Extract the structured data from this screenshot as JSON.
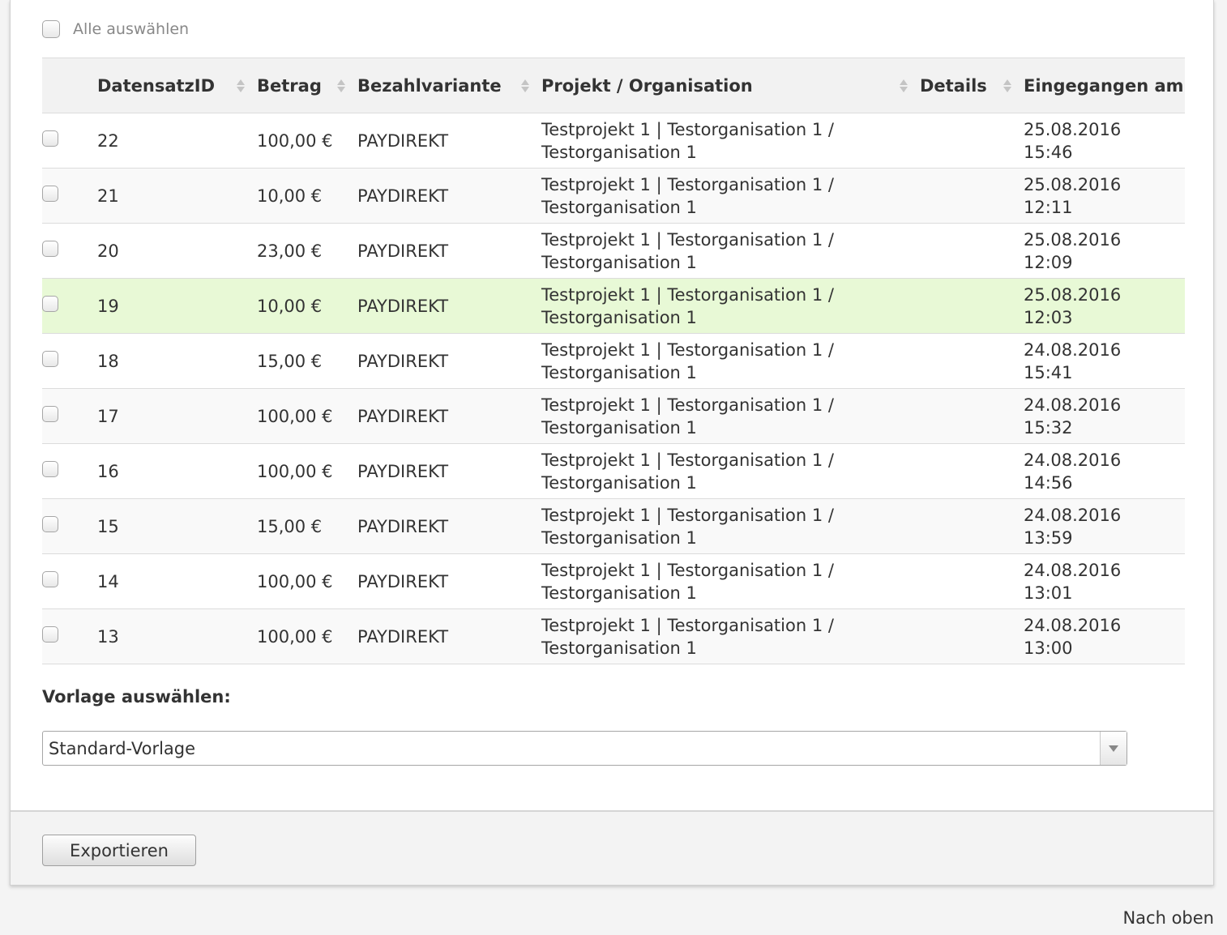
{
  "select_all": {
    "label": "Alle auswählen"
  },
  "table": {
    "headers": {
      "id": "DatensatzID",
      "amount": "Betrag",
      "payment": "Bezahlvariante",
      "project": "Projekt / Organisation",
      "details": "Details",
      "received": "Eingegangen am"
    },
    "rows": [
      {
        "id": "22",
        "amount": "100,00 €",
        "payment": "PAYDIREKT",
        "project": "Testprojekt 1 | Testorganisation 1 / Testorganisation 1",
        "details": "",
        "date": "25.08.2016",
        "time": "15:46"
      },
      {
        "id": "21",
        "amount": "10,00 €",
        "payment": "PAYDIREKT",
        "project": "Testprojekt 1 | Testorganisation 1 / Testorganisation 1",
        "details": "",
        "date": "25.08.2016",
        "time": "12:11"
      },
      {
        "id": "20",
        "amount": "23,00 €",
        "payment": "PAYDIREKT",
        "project": "Testprojekt 1 | Testorganisation 1 / Testorganisation 1",
        "details": "",
        "date": "25.08.2016",
        "time": "12:09"
      },
      {
        "id": "19",
        "amount": "10,00 €",
        "payment": "PAYDIREKT",
        "project": "Testprojekt 1 | Testorganisation 1 / Testorganisation 1",
        "details": "",
        "date": "25.08.2016",
        "time": "12:03",
        "highlighted": true
      },
      {
        "id": "18",
        "amount": "15,00 €",
        "payment": "PAYDIREKT",
        "project": "Testprojekt 1 | Testorganisation 1 / Testorganisation 1",
        "details": "",
        "date": "24.08.2016",
        "time": "15:41"
      },
      {
        "id": "17",
        "amount": "100,00 €",
        "payment": "PAYDIREKT",
        "project": "Testprojekt 1 | Testorganisation 1 / Testorganisation 1",
        "details": "",
        "date": "24.08.2016",
        "time": "15:32"
      },
      {
        "id": "16",
        "amount": "100,00 €",
        "payment": "PAYDIREKT",
        "project": "Testprojekt 1 | Testorganisation 1 / Testorganisation 1",
        "details": "",
        "date": "24.08.2016",
        "time": "14:56"
      },
      {
        "id": "15",
        "amount": "15,00 €",
        "payment": "PAYDIREKT",
        "project": "Testprojekt 1 | Testorganisation 1 / Testorganisation 1",
        "details": "",
        "date": "24.08.2016",
        "time": "13:59"
      },
      {
        "id": "14",
        "amount": "100,00 €",
        "payment": "PAYDIREKT",
        "project": "Testprojekt 1 | Testorganisation 1 / Testorganisation 1",
        "details": "",
        "date": "24.08.2016",
        "time": "13:01"
      },
      {
        "id": "13",
        "amount": "100,00 €",
        "payment": "PAYDIREKT",
        "project": "Testprojekt 1 | Testorganisation 1 / Testorganisation 1",
        "details": "",
        "date": "24.08.2016",
        "time": "13:00"
      }
    ]
  },
  "template": {
    "label": "Vorlage auswählen:",
    "selected": "Standard-Vorlage"
  },
  "footer": {
    "export_label": "Exportieren"
  },
  "back_to_top": "Nach oben",
  "colors": {
    "highlight_row": "#e8f9d6",
    "header_bg": "#f2f2f2"
  },
  "icons": {
    "sort": "sort-icon",
    "dropdown": "chevron-down-icon"
  }
}
